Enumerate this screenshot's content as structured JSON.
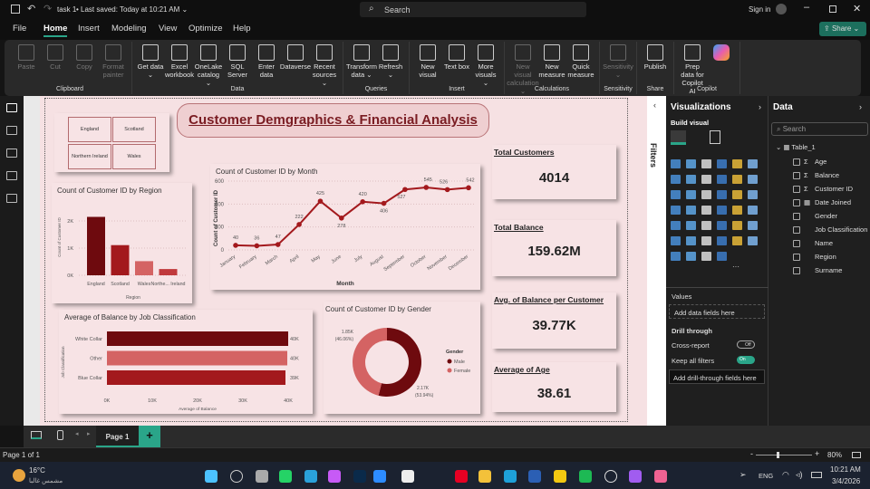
{
  "titlebar": {
    "file_name": "task 1",
    "saved": "Last saved: Today at 10:21 AM",
    "search_placeholder": "Search",
    "sign_in": "Sign in",
    "share": "Share"
  },
  "menu": [
    "File",
    "Home",
    "Insert",
    "Modeling",
    "View",
    "Optimize",
    "Help"
  ],
  "ribbon": [
    {
      "group": "Clipboard",
      "items": [
        {
          "label": "Paste",
          "disabled": true
        },
        {
          "label": "Cut",
          "disabled": true
        },
        {
          "label": "Copy",
          "disabled": true
        },
        {
          "label": "Format painter",
          "disabled": true
        }
      ]
    },
    {
      "group": "Data",
      "items": [
        {
          "label": "Get data ⌄"
        },
        {
          "label": "Excel workbook"
        },
        {
          "label": "OneLake catalog ⌄"
        },
        {
          "label": "SQL Server"
        },
        {
          "label": "Enter data"
        },
        {
          "label": "Dataverse"
        },
        {
          "label": "Recent sources ⌄"
        }
      ]
    },
    {
      "group": "Queries",
      "items": [
        {
          "label": "Transform data ⌄"
        },
        {
          "label": "Refresh ⌄"
        }
      ]
    },
    {
      "group": "Insert",
      "items": [
        {
          "label": "New visual"
        },
        {
          "label": "Text box"
        },
        {
          "label": "More visuals ⌄"
        }
      ]
    },
    {
      "group": "Calculations",
      "items": [
        {
          "label": "New visual calculation ⌄",
          "disabled": true
        },
        {
          "label": "New measure"
        },
        {
          "label": "Quick measure"
        }
      ]
    },
    {
      "group": "Sensitivity",
      "items": [
        {
          "label": "Sensitivity ⌄",
          "disabled": true
        }
      ]
    },
    {
      "group": "Share",
      "items": [
        {
          "label": "Publish"
        }
      ]
    },
    {
      "group": "Copilot",
      "items": [
        {
          "label": "Prep data for Copilot AI"
        },
        {
          "label": ""
        }
      ]
    }
  ],
  "report": {
    "title": "Customer Demgraphics & Financial Analysis",
    "slicer": [
      "England",
      "Scotland",
      "Northern Ireland",
      "Wales"
    ],
    "kpis": [
      {
        "label": "Total Customers",
        "value": "4014"
      },
      {
        "label": "Total Balance",
        "value": "159.62M"
      },
      {
        "label": "Avg. of Balance per Customer",
        "value": "39.77K"
      },
      {
        "label": "Average of Age",
        "value": "38.61"
      }
    ]
  },
  "colors": {
    "dark_red": "#6e0a0e",
    "red": "#a3191d",
    "light_red": "#d46363",
    "accent": "#2aa589"
  },
  "chart_data": [
    {
      "type": "line",
      "title": "Count of Customer ID by Month",
      "xlabel": "Month",
      "ylabel": "Count of Customer ID",
      "categories": [
        "January",
        "February",
        "March",
        "April",
        "May",
        "June",
        "July",
        "August",
        "September",
        "October",
        "November",
        "December"
      ],
      "values": [
        40,
        36,
        47,
        222,
        425,
        278,
        420,
        406,
        527,
        545,
        526,
        542
      ],
      "ylim": [
        0,
        600
      ],
      "yticks": [
        "0",
        "200",
        "400",
        "600"
      ],
      "grid": true
    },
    {
      "type": "bar",
      "title": "Count of Customer ID by Region",
      "xlabel": "Region",
      "ylabel": "Count of Customer ID",
      "categories": [
        "England",
        "Scotland",
        "Wales",
        "Northe... Ireland"
      ],
      "values": [
        2150,
        1110,
        520,
        230
      ],
      "ylim": [
        0,
        2300
      ],
      "yticks": [
        "0K",
        "1K",
        "2K"
      ],
      "grid": true
    },
    {
      "type": "bar",
      "orientation": "horizontal",
      "title": "Average of Balance by Job Classification",
      "xlabel": "Average of Balance",
      "ylabel": "Job Classification",
      "categories": [
        "White Collar",
        "Other",
        "Blue Collar"
      ],
      "values": [
        40000,
        39800,
        39400
      ],
      "data_labels": [
        "40K",
        "40K",
        "39K"
      ],
      "xlim": [
        0,
        40000
      ],
      "xticks": [
        "0K",
        "10K",
        "20K",
        "30K",
        "40K"
      ]
    },
    {
      "type": "pie",
      "donut": true,
      "title": "Count of Customer ID by Gender",
      "legend_title": "Gender",
      "legend_position": "right",
      "series": [
        {
          "name": "Male",
          "value": 2170,
          "label": "2.17K",
          "pct": "(53.94%)"
        },
        {
          "name": "Female",
          "value": 1850,
          "label": "1.85K",
          "pct": "(46.06%)"
        }
      ]
    }
  ],
  "filters_label": "Filters",
  "viz_pane": {
    "title": "Visualizations",
    "build": "Build visual",
    "values": "Values",
    "add_fields": "Add data fields here",
    "drill": "Drill through",
    "cross": "Cross-report",
    "cross_state": "Off",
    "keep": "Keep all filters",
    "keep_state": "On",
    "add_drill": "Add drill-through fields here"
  },
  "data_pane": {
    "title": "Data",
    "search": "Search",
    "table": "Table_1",
    "fields": [
      {
        "name": "Age",
        "sigma": true
      },
      {
        "name": "Balance",
        "sigma": true
      },
      {
        "name": "Customer ID",
        "sigma": true
      },
      {
        "name": "Date Joined",
        "date": true
      },
      {
        "name": "Gender"
      },
      {
        "name": "Job Classification"
      },
      {
        "name": "Name"
      },
      {
        "name": "Region"
      },
      {
        "name": "Surname"
      }
    ]
  },
  "pages": {
    "tab": "Page 1",
    "status": "Page 1 of 1",
    "zoom": "80%"
  },
  "taskbar": {
    "temp": "16°C",
    "weather": "مشمس غالبا",
    "lang": "ENG",
    "time": "10:21 AM",
    "date": "3/4/2026"
  }
}
